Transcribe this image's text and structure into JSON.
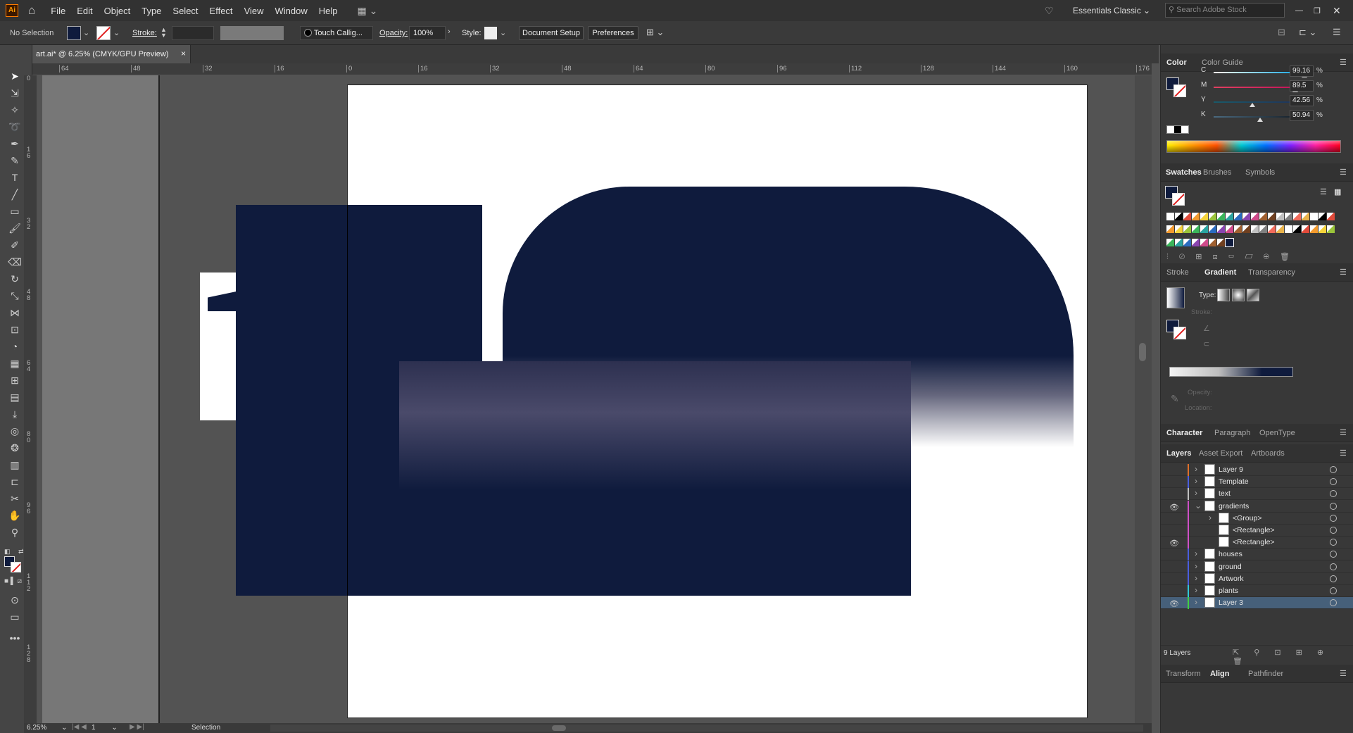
{
  "app": {
    "logo": "Ai"
  },
  "menu": {
    "items": [
      "File",
      "Edit",
      "Object",
      "Type",
      "Select",
      "Effect",
      "View",
      "Window",
      "Help"
    ],
    "workspace": "Essentials Classic",
    "search_placeholder": "Search Adobe Stock"
  },
  "control": {
    "selection": "No Selection",
    "stroke_label": "Stroke:",
    "brush": "Touch Callig...",
    "opacity_label": "Opacity:",
    "opacity_value": "100%",
    "style_label": "Style:",
    "doc_setup": "Document Setup",
    "preferences": "Preferences"
  },
  "document": {
    "tab_title": "art.ai* @ 6.25% (CMYK/GPU Preview)",
    "close": "×"
  },
  "rulers": {
    "h": [
      "64",
      "48",
      "32",
      "16",
      "0",
      "16",
      "32",
      "48",
      "64",
      "80",
      "96",
      "112",
      "128",
      "144",
      "160",
      "176"
    ],
    "v": [
      "0",
      "1 6",
      "3 2",
      "4 8",
      "6 4",
      "8 0",
      "9 6",
      "1 1 2",
      "1 2 8"
    ]
  },
  "status": {
    "zoom": "6.25%",
    "artboard": "1",
    "tool": "Selection"
  },
  "color_panel": {
    "tabs": [
      "Color",
      "Color Guide"
    ],
    "channels": [
      {
        "label": "C",
        "value": "99.16",
        "pct": 0.9916
      },
      {
        "label": "M",
        "value": "89.5",
        "pct": 0.895
      },
      {
        "label": "Y",
        "value": "42.56",
        "pct": 0.4256
      },
      {
        "label": "K",
        "value": "50.94",
        "pct": 0.5094
      }
    ],
    "unit": "%"
  },
  "swatches_panel": {
    "tabs": [
      "Swatches",
      "Brushes",
      "Symbols"
    ]
  },
  "gradient_panel": {
    "tabs": [
      "Stroke",
      "Gradient",
      "Transparency"
    ],
    "type_label": "Type:",
    "stroke_label": "Stroke:",
    "opacity_label": "Opacity:",
    "location_label": "Location:"
  },
  "char_panel": {
    "tabs": [
      "Character",
      "Paragraph",
      "OpenType"
    ]
  },
  "layers_panel": {
    "tabs": [
      "Layers",
      "Asset Export",
      "Artboards"
    ],
    "count": "9 Layers",
    "layers": [
      {
        "name": "Layer 9",
        "color": "#e0702a",
        "visible": false,
        "indent": 0,
        "expand": "›",
        "selected": false
      },
      {
        "name": "Template",
        "color": "#4a5ee0",
        "visible": false,
        "indent": 0,
        "expand": "›",
        "selected": false
      },
      {
        "name": "text",
        "color": "#c0c0c0",
        "visible": false,
        "indent": 0,
        "expand": "›",
        "selected": false
      },
      {
        "name": "gradients",
        "color": "#d050c8",
        "visible": true,
        "indent": 0,
        "expand": "⌄",
        "selected": false
      },
      {
        "name": "<Group>",
        "color": "#d050c8",
        "visible": false,
        "indent": 1,
        "expand": "›",
        "selected": false
      },
      {
        "name": "<Rectangle>",
        "color": "#d050c8",
        "visible": false,
        "indent": 1,
        "expand": "",
        "selected": false
      },
      {
        "name": "<Rectangle>",
        "color": "#d050c8",
        "visible": true,
        "indent": 1,
        "expand": "",
        "selected": false
      },
      {
        "name": "houses",
        "color": "#4a5ee0",
        "visible": false,
        "indent": 0,
        "expand": "›",
        "selected": false
      },
      {
        "name": "ground",
        "color": "#4a5ee0",
        "visible": false,
        "indent": 0,
        "expand": "›",
        "selected": false
      },
      {
        "name": "Artwork",
        "color": "#4a5ee0",
        "visible": false,
        "indent": 0,
        "expand": "›",
        "selected": false
      },
      {
        "name": "plants",
        "color": "#30c8d8",
        "visible": false,
        "indent": 0,
        "expand": "›",
        "selected": false
      },
      {
        "name": "Layer 3",
        "color": "#40d040",
        "visible": true,
        "indent": 0,
        "expand": "›",
        "selected": true
      }
    ]
  },
  "bottom_panel": {
    "tabs": [
      "Transform",
      "Align",
      "Pathfinder"
    ]
  },
  "colors": {
    "navy": "#0f1b3d",
    "accent": "#46607a"
  }
}
